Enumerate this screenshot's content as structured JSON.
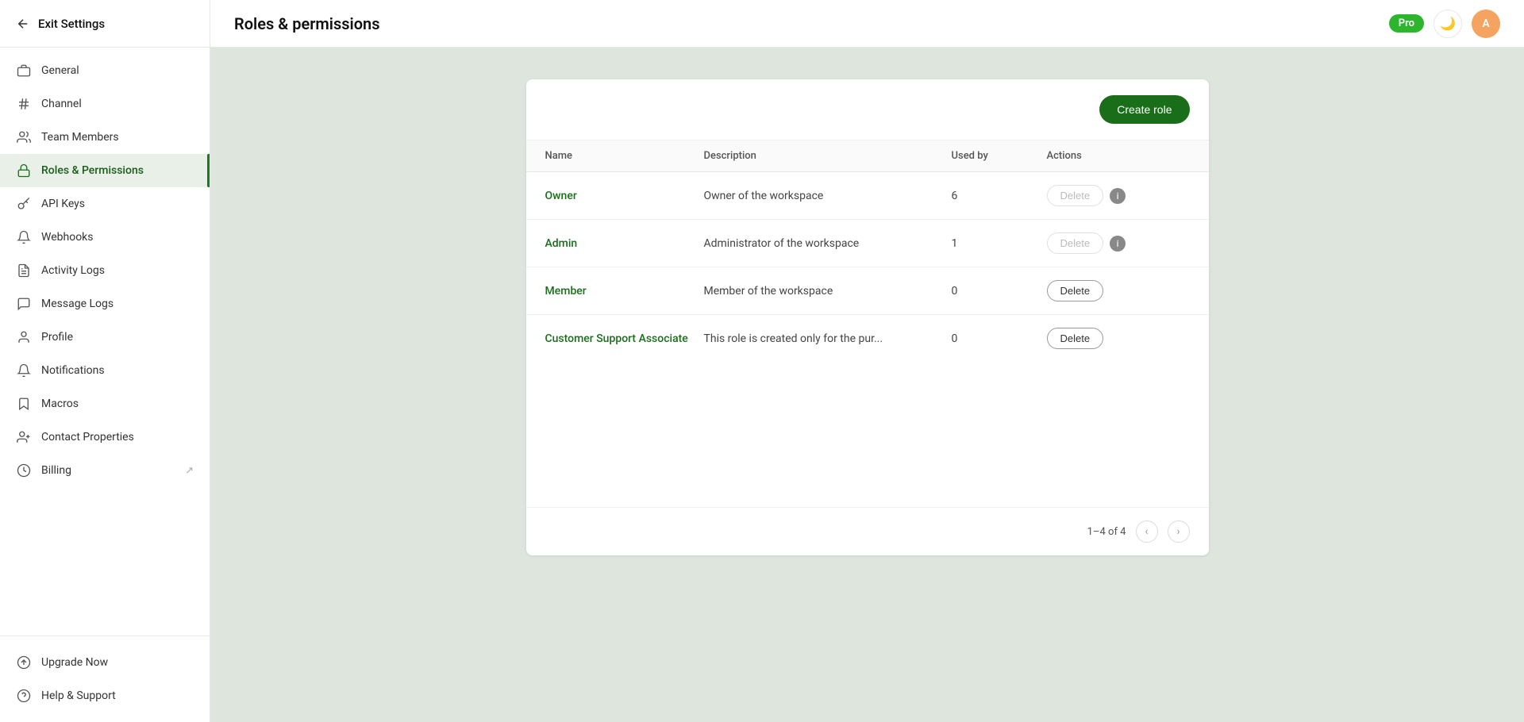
{
  "sidebar": {
    "back_label": "Exit Settings",
    "items": [
      {
        "id": "general",
        "label": "General",
        "icon": "briefcase",
        "active": false
      },
      {
        "id": "channel",
        "label": "Channel",
        "icon": "hash",
        "active": false
      },
      {
        "id": "team-members",
        "label": "Team Members",
        "icon": "users",
        "active": false
      },
      {
        "id": "roles-permissions",
        "label": "Roles & Permissions",
        "icon": "lock",
        "active": true
      },
      {
        "id": "api-keys",
        "label": "API Keys",
        "icon": "gear",
        "active": false
      },
      {
        "id": "webhooks",
        "label": "Webhooks",
        "icon": "webhook",
        "active": false
      },
      {
        "id": "activity-logs",
        "label": "Activity Logs",
        "icon": "file-list",
        "active": false
      },
      {
        "id": "message-logs",
        "label": "Message Logs",
        "icon": "message",
        "active": false
      },
      {
        "id": "profile",
        "label": "Profile",
        "icon": "person",
        "active": false
      },
      {
        "id": "notifications",
        "label": "Notifications",
        "icon": "bell",
        "active": false
      },
      {
        "id": "macros",
        "label": "Macros",
        "icon": "bookmark",
        "active": false
      },
      {
        "id": "contact-properties",
        "label": "Contact Properties",
        "icon": "contact",
        "active": false
      },
      {
        "id": "billing",
        "label": "Billing",
        "icon": "dollar",
        "active": false
      }
    ],
    "footer_items": [
      {
        "id": "upgrade-now",
        "label": "Upgrade Now",
        "icon": "upgrade"
      },
      {
        "id": "help-support",
        "label": "Help & Support",
        "icon": "help"
      }
    ]
  },
  "header": {
    "title": "Roles & permissions",
    "pro_badge": "Pro",
    "avatar_letter": "A"
  },
  "table": {
    "create_role_label": "Create role",
    "columns": [
      "Name",
      "Description",
      "Used by",
      "Actions"
    ],
    "rows": [
      {
        "name": "Owner",
        "description": "Owner of the workspace",
        "used_by": "6",
        "delete_label": "Delete",
        "delete_disabled": true,
        "has_info": true
      },
      {
        "name": "Admin",
        "description": "Administrator of the workspace",
        "used_by": "1",
        "delete_label": "Delete",
        "delete_disabled": true,
        "has_info": true
      },
      {
        "name": "Member",
        "description": "Member of the workspace",
        "used_by": "0",
        "delete_label": "Delete",
        "delete_disabled": false,
        "has_info": false
      },
      {
        "name": "Customer Support Associate",
        "description": "This role is created only for the pur...",
        "used_by": "0",
        "delete_label": "Delete",
        "delete_disabled": false,
        "has_info": false
      }
    ],
    "pagination": {
      "info": "1–4 of 4"
    }
  }
}
